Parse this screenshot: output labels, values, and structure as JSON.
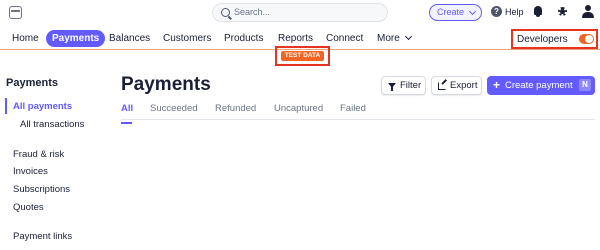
{
  "topbar": {
    "search_placeholder": "Search...",
    "create_label": "Create",
    "help_label": "Help"
  },
  "nav": {
    "items": [
      "Home",
      "Payments",
      "Balances",
      "Customers",
      "Products",
      "Reports",
      "Connect",
      "More"
    ],
    "active": "Payments",
    "developers_label": "Developers",
    "developers_toggle_on": true,
    "test_data_badge": "TEST DATA"
  },
  "sidebar": {
    "title": "Payments",
    "items": [
      "All payments",
      "All transactions",
      "Fraud & risk",
      "Invoices",
      "Subscriptions",
      "Quotes",
      "Payment links"
    ],
    "active": "All payments"
  },
  "main": {
    "title": "Payments",
    "filter_label": "Filter",
    "export_label": "Export",
    "create_payment_label": "Create payment",
    "create_payment_shortcut": "N",
    "tabs": [
      "All",
      "Succeeded",
      "Refunded",
      "Uncaptured",
      "Failed"
    ],
    "active_tab": "All"
  },
  "colors": {
    "accent": "#635bff",
    "test_mode": "#f26522",
    "highlight_box": "#e5341f"
  }
}
